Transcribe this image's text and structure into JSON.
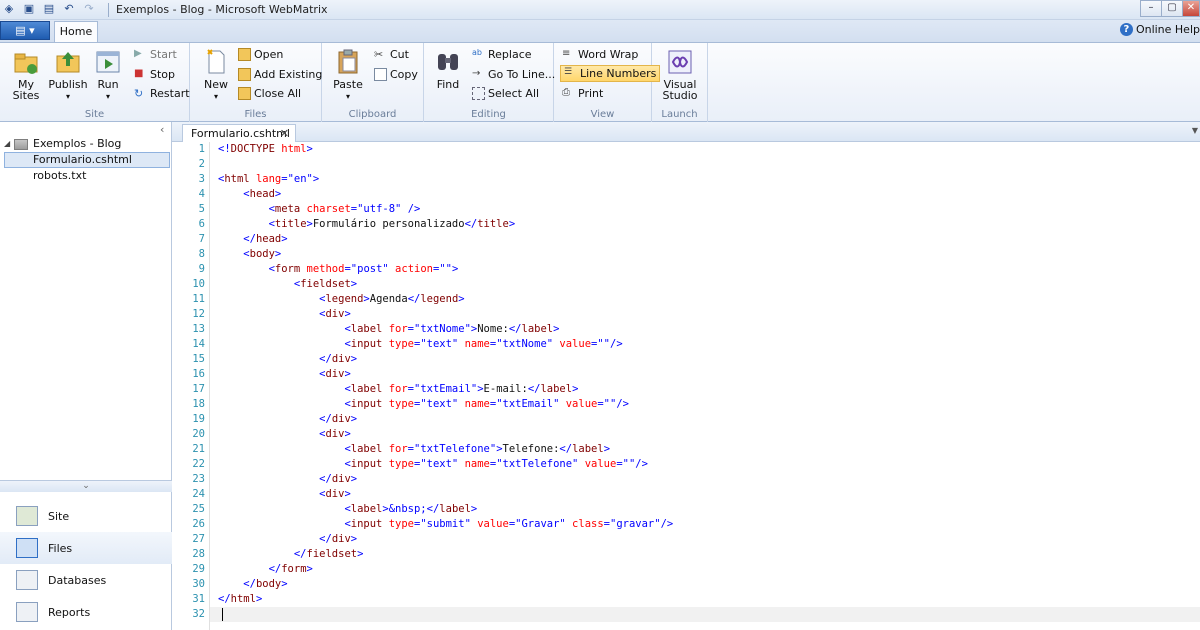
{
  "window": {
    "title": "Exemplos - Blog - Microsoft WebMatrix",
    "controls": {
      "minimize": "–",
      "maximize": "▢",
      "close": "✕"
    }
  },
  "ribbon_tabs": {
    "app_menu": "▤ ▾",
    "home": "Home",
    "online_help": "Online Help"
  },
  "ribbon": {
    "site": {
      "label": "Site",
      "my_sites": [
        "My",
        "Sites"
      ],
      "publish": "Publish",
      "run": "Run",
      "start": "Start",
      "stop": "Stop",
      "restart": "Restart"
    },
    "files": {
      "label": "Files",
      "new": "New",
      "open": "Open",
      "add_existing": "Add Existing",
      "close_all": "Close All"
    },
    "clipboard": {
      "label": "Clipboard",
      "paste": "Paste",
      "cut": "Cut",
      "copy": "Copy"
    },
    "editing": {
      "label": "Editing",
      "find": "Find",
      "replace": "Replace",
      "go_to_line": "Go To Line...",
      "select_all": "Select All"
    },
    "view": {
      "label": "View",
      "word_wrap": "Word Wrap",
      "line_numbers": "Line Numbers",
      "print": "Print"
    },
    "launch": {
      "label": "Launch",
      "visual_studio": [
        "Visual",
        "Studio"
      ]
    }
  },
  "tree": {
    "root": "Exemplos - Blog",
    "files": [
      "Formulario.cshtml",
      "robots.txt"
    ]
  },
  "nav": [
    "Site",
    "Files",
    "Databases",
    "Reports"
  ],
  "editor": {
    "tab": "Formulario.cshtml",
    "line_numbers": [
      "1",
      "2",
      "3",
      "4",
      "5",
      "6",
      "7",
      "8",
      "9",
      "10",
      "11",
      "12",
      "13",
      "14",
      "15",
      "16",
      "17",
      "18",
      "19",
      "20",
      "21",
      "22",
      "23",
      "24",
      "25",
      "26",
      "27",
      "28",
      "29",
      "30",
      "31",
      "32"
    ],
    "colors": {
      "tag": "#800000",
      "attr": "#ff0000",
      "value": "#0000ff",
      "text": "#111111",
      "line_number": "#2b91af"
    },
    "lines": [
      [
        [
          "p",
          "<!"
        ],
        [
          "t",
          "DOCTYPE"
        ],
        [
          "a",
          " html"
        ],
        [
          "p",
          ">"
        ]
      ],
      [],
      [
        [
          "p",
          "<"
        ],
        [
          "t",
          "html"
        ],
        [
          "a",
          " lang"
        ],
        [
          "p",
          "="
        ],
        [
          "v",
          "\"en\""
        ],
        [
          "p",
          ">"
        ]
      ],
      [
        [
          "x",
          "    "
        ],
        [
          "p",
          "<"
        ],
        [
          "t",
          "head"
        ],
        [
          "p",
          ">"
        ]
      ],
      [
        [
          "x",
          "        "
        ],
        [
          "p",
          "<"
        ],
        [
          "t",
          "meta"
        ],
        [
          "a",
          " charset"
        ],
        [
          "p",
          "="
        ],
        [
          "v",
          "\"utf-8\""
        ],
        [
          "p",
          " />"
        ]
      ],
      [
        [
          "x",
          "        "
        ],
        [
          "p",
          "<"
        ],
        [
          "t",
          "title"
        ],
        [
          "p",
          ">"
        ],
        [
          "x",
          "Formulário personalizado"
        ],
        [
          "p",
          "</"
        ],
        [
          "t",
          "title"
        ],
        [
          "p",
          ">"
        ]
      ],
      [
        [
          "x",
          "    "
        ],
        [
          "p",
          "</"
        ],
        [
          "t",
          "head"
        ],
        [
          "p",
          ">"
        ]
      ],
      [
        [
          "x",
          "    "
        ],
        [
          "p",
          "<"
        ],
        [
          "t",
          "body"
        ],
        [
          "p",
          ">"
        ]
      ],
      [
        [
          "x",
          "        "
        ],
        [
          "p",
          "<"
        ],
        [
          "t",
          "form"
        ],
        [
          "a",
          " method"
        ],
        [
          "p",
          "="
        ],
        [
          "v",
          "\"post\""
        ],
        [
          "a",
          " action"
        ],
        [
          "p",
          "="
        ],
        [
          "v",
          "\"\""
        ],
        [
          "p",
          ">"
        ]
      ],
      [
        [
          "x",
          "            "
        ],
        [
          "p",
          "<"
        ],
        [
          "t",
          "fieldset"
        ],
        [
          "p",
          ">"
        ]
      ],
      [
        [
          "x",
          "                "
        ],
        [
          "p",
          "<"
        ],
        [
          "t",
          "legend"
        ],
        [
          "p",
          ">"
        ],
        [
          "x",
          "Agenda"
        ],
        [
          "p",
          "</"
        ],
        [
          "t",
          "legend"
        ],
        [
          "p",
          ">"
        ]
      ],
      [
        [
          "x",
          "                "
        ],
        [
          "p",
          "<"
        ],
        [
          "t",
          "div"
        ],
        [
          "p",
          ">"
        ]
      ],
      [
        [
          "x",
          "                    "
        ],
        [
          "p",
          "<"
        ],
        [
          "t",
          "label"
        ],
        [
          "a",
          " for"
        ],
        [
          "p",
          "="
        ],
        [
          "v",
          "\"txtNome\""
        ],
        [
          "p",
          ">"
        ],
        [
          "x",
          "Nome:"
        ],
        [
          "p",
          "</"
        ],
        [
          "t",
          "label"
        ],
        [
          "p",
          ">"
        ]
      ],
      [
        [
          "x",
          "                    "
        ],
        [
          "p",
          "<"
        ],
        [
          "t",
          "input"
        ],
        [
          "a",
          " type"
        ],
        [
          "p",
          "="
        ],
        [
          "v",
          "\"text\""
        ],
        [
          "a",
          " name"
        ],
        [
          "p",
          "="
        ],
        [
          "v",
          "\"txtNome\""
        ],
        [
          "a",
          " value"
        ],
        [
          "p",
          "="
        ],
        [
          "v",
          "\"\""
        ],
        [
          "p",
          "/>"
        ]
      ],
      [
        [
          "x",
          "                "
        ],
        [
          "p",
          "</"
        ],
        [
          "t",
          "div"
        ],
        [
          "p",
          ">"
        ]
      ],
      [
        [
          "x",
          "                "
        ],
        [
          "p",
          "<"
        ],
        [
          "t",
          "div"
        ],
        [
          "p",
          ">"
        ]
      ],
      [
        [
          "x",
          "                    "
        ],
        [
          "p",
          "<"
        ],
        [
          "t",
          "label"
        ],
        [
          "a",
          " for"
        ],
        [
          "p",
          "="
        ],
        [
          "v",
          "\"txtEmail\""
        ],
        [
          "p",
          ">"
        ],
        [
          "x",
          "E-mail:"
        ],
        [
          "p",
          "</"
        ],
        [
          "t",
          "label"
        ],
        [
          "p",
          ">"
        ]
      ],
      [
        [
          "x",
          "                    "
        ],
        [
          "p",
          "<"
        ],
        [
          "t",
          "input"
        ],
        [
          "a",
          " type"
        ],
        [
          "p",
          "="
        ],
        [
          "v",
          "\"text\""
        ],
        [
          "a",
          " name"
        ],
        [
          "p",
          "="
        ],
        [
          "v",
          "\"txtEmail\""
        ],
        [
          "a",
          " value"
        ],
        [
          "p",
          "="
        ],
        [
          "v",
          "\"\""
        ],
        [
          "p",
          "/>"
        ]
      ],
      [
        [
          "x",
          "                "
        ],
        [
          "p",
          "</"
        ],
        [
          "t",
          "div"
        ],
        [
          "p",
          ">"
        ]
      ],
      [
        [
          "x",
          "                "
        ],
        [
          "p",
          "<"
        ],
        [
          "t",
          "div"
        ],
        [
          "p",
          ">"
        ]
      ],
      [
        [
          "x",
          "                    "
        ],
        [
          "p",
          "<"
        ],
        [
          "t",
          "label"
        ],
        [
          "a",
          " for"
        ],
        [
          "p",
          "="
        ],
        [
          "v",
          "\"txtTelefone\""
        ],
        [
          "p",
          ">"
        ],
        [
          "x",
          "Telefone:"
        ],
        [
          "p",
          "</"
        ],
        [
          "t",
          "label"
        ],
        [
          "p",
          ">"
        ]
      ],
      [
        [
          "x",
          "                    "
        ],
        [
          "p",
          "<"
        ],
        [
          "t",
          "input"
        ],
        [
          "a",
          " type"
        ],
        [
          "p",
          "="
        ],
        [
          "v",
          "\"text\""
        ],
        [
          "a",
          " name"
        ],
        [
          "p",
          "="
        ],
        [
          "v",
          "\"txtTelefone\""
        ],
        [
          "a",
          " value"
        ],
        [
          "p",
          "="
        ],
        [
          "v",
          "\"\""
        ],
        [
          "p",
          "/>"
        ]
      ],
      [
        [
          "x",
          "                "
        ],
        [
          "p",
          "</"
        ],
        [
          "t",
          "div"
        ],
        [
          "p",
          ">"
        ]
      ],
      [
        [
          "x",
          "                "
        ],
        [
          "p",
          "<"
        ],
        [
          "t",
          "div"
        ],
        [
          "p",
          ">"
        ]
      ],
      [
        [
          "x",
          "                    "
        ],
        [
          "p",
          "<"
        ],
        [
          "t",
          "label"
        ],
        [
          "p",
          ">"
        ],
        [
          "p",
          "&nbsp;"
        ],
        [
          "p",
          "</"
        ],
        [
          "t",
          "label"
        ],
        [
          "p",
          ">"
        ]
      ],
      [
        [
          "x",
          "                    "
        ],
        [
          "p",
          "<"
        ],
        [
          "t",
          "input"
        ],
        [
          "a",
          " type"
        ],
        [
          "p",
          "="
        ],
        [
          "v",
          "\"submit\""
        ],
        [
          "a",
          " value"
        ],
        [
          "p",
          "="
        ],
        [
          "v",
          "\"Gravar\""
        ],
        [
          "a",
          " class"
        ],
        [
          "p",
          "="
        ],
        [
          "v",
          "\"gravar\""
        ],
        [
          "p",
          "/>"
        ]
      ],
      [
        [
          "x",
          "                "
        ],
        [
          "p",
          "</"
        ],
        [
          "t",
          "div"
        ],
        [
          "p",
          ">"
        ]
      ],
      [
        [
          "x",
          "            "
        ],
        [
          "p",
          "</"
        ],
        [
          "t",
          "fieldset"
        ],
        [
          "p",
          ">"
        ]
      ],
      [
        [
          "x",
          "        "
        ],
        [
          "p",
          "</"
        ],
        [
          "t",
          "form"
        ],
        [
          "p",
          ">"
        ]
      ],
      [
        [
          "x",
          "    "
        ],
        [
          "p",
          "</"
        ],
        [
          "t",
          "body"
        ],
        [
          "p",
          ">"
        ]
      ],
      [
        [
          "p",
          "</"
        ],
        [
          "t",
          "html"
        ],
        [
          "p",
          ">"
        ]
      ],
      []
    ]
  }
}
